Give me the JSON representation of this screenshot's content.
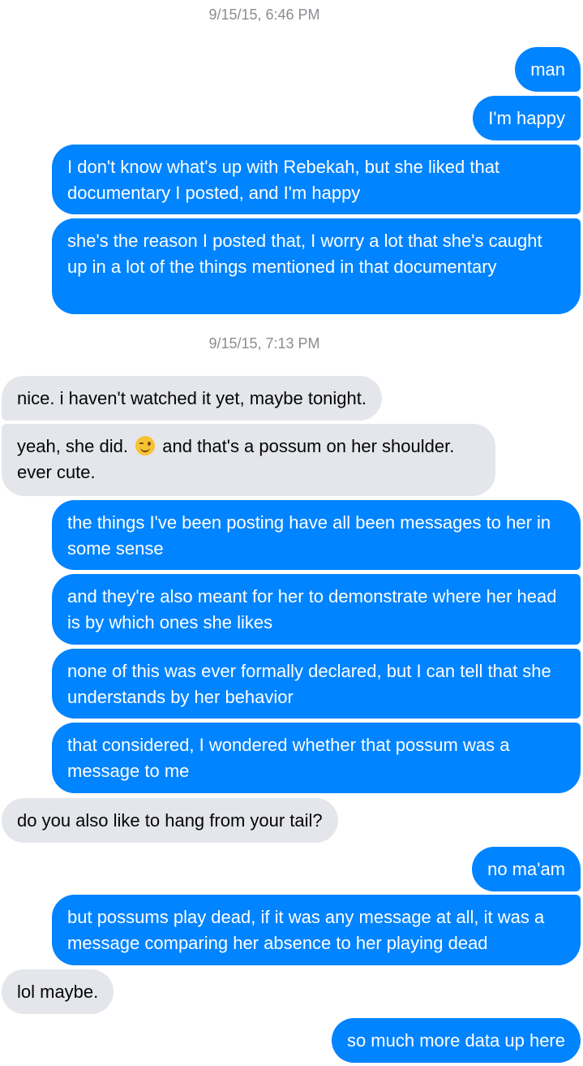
{
  "timestamps": [
    "9/15/15, 6:46 PM",
    "9/15/15, 7:13 PM"
  ],
  "messages": [
    {
      "sender": "me",
      "text": "man"
    },
    {
      "sender": "me",
      "text": "I'm happy"
    },
    {
      "sender": "me",
      "text": "I don't know what's up with Rebekah, but she liked that documentary I posted, and I'm happy"
    },
    {
      "sender": "me",
      "text": "she's the reason I posted that, I worry a lot that she's caught up in a lot of the things mentioned in that documentary"
    },
    {
      "sender": "them",
      "text": "nice. i haven't watched it yet, maybe tonight."
    },
    {
      "sender": "them",
      "text_before": "yeah, she did.",
      "emoji": "winking-face-emoji",
      "text_after": "and that's a possum on her shoulder. ever cute."
    },
    {
      "sender": "me",
      "text": "the things I've been posting have all been messages to her in some sense"
    },
    {
      "sender": "me",
      "text": "and they're also meant for her to demonstrate where her head is by which ones she likes"
    },
    {
      "sender": "me",
      "text": "none of this was ever formally declared, but I can tell that she understands by her behavior"
    },
    {
      "sender": "me",
      "text": "that considered, I wondered whether that possum was a message to me"
    },
    {
      "sender": "them",
      "text": "do you also like to hang from your tail?"
    },
    {
      "sender": "me",
      "text": "no ma'am"
    },
    {
      "sender": "me",
      "text": "but possums play dead, if it was any message at all, it was a message comparing her absence to her playing dead"
    },
    {
      "sender": "them",
      "text": "lol maybe."
    },
    {
      "sender": "me",
      "text": "so much more data up here"
    }
  ],
  "colors": {
    "sent_bubble": "#0084ff",
    "received_bubble": "#e4e6eb",
    "timestamp_text": "#8a8d91"
  }
}
